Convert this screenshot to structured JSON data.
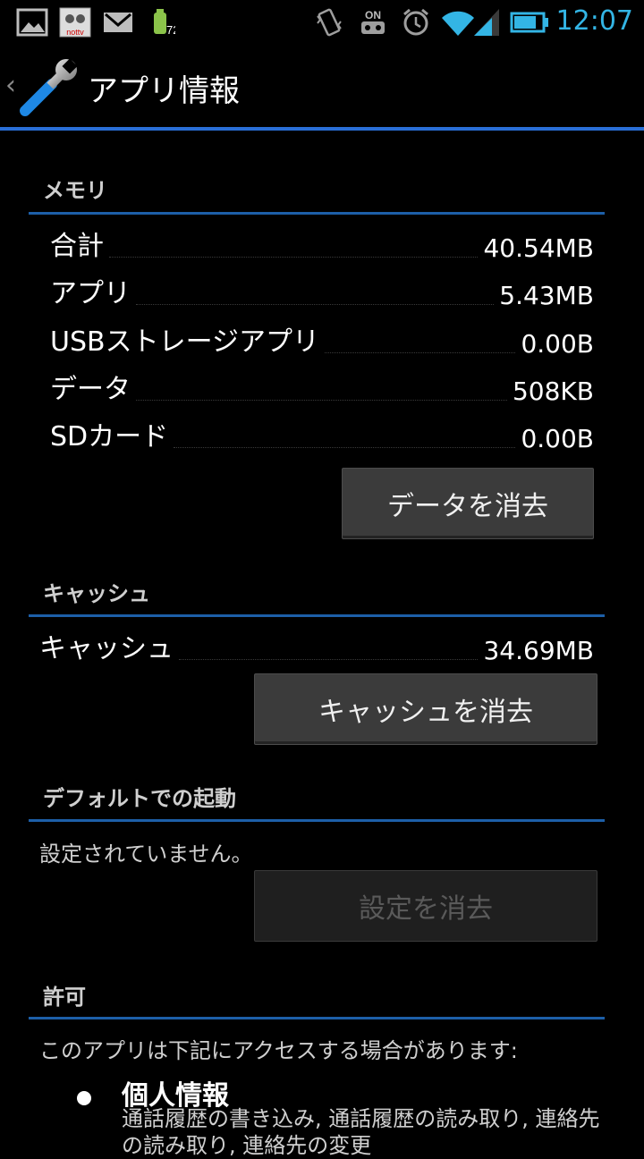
{
  "status_bar": {
    "time": "12:07",
    "on_label": "ON",
    "notif_tv_label": "nottv",
    "battery_badge": "72",
    "icons": [
      "image-icon",
      "nottv-icon",
      "gmail-icon",
      "android-update-icon",
      "vibrate-icon",
      "on-icon",
      "alarm-icon",
      "wifi-icon",
      "signal-icon",
      "battery-icon"
    ]
  },
  "action_bar": {
    "title": "アプリ情報"
  },
  "memory": {
    "header": "メモリ",
    "rows": [
      {
        "label": "合計",
        "value": "40.54MB"
      },
      {
        "label": "アプリ",
        "value": "5.43MB"
      },
      {
        "label": "USBストレージアプリ",
        "value": "0.00B"
      },
      {
        "label": "データ",
        "value": "508KB"
      },
      {
        "label": "SDカード",
        "value": "0.00B"
      }
    ],
    "clear_data_label": "データを消去"
  },
  "cache": {
    "header": "キャッシュ",
    "row": {
      "label": "キャッシュ",
      "value": "34.69MB"
    },
    "clear_cache_label": "キャッシュを消去"
  },
  "defaults": {
    "header": "デフォルトでの起動",
    "status": "設定されていません。",
    "clear_defaults_label": "設定を消去"
  },
  "permissions": {
    "header": "許可",
    "intro": "このアプリは下記にアクセスする場合があります:",
    "items": [
      {
        "title": "個人情報",
        "desc": "通話履歴の書き込み, 通話履歴の読み取り, 連絡先の読み取り, 連絡先の変更"
      }
    ]
  },
  "colors": {
    "accent": "#33b5e5",
    "divider": "#1d5fa8",
    "action_bar_line": "#2a6fd6"
  }
}
